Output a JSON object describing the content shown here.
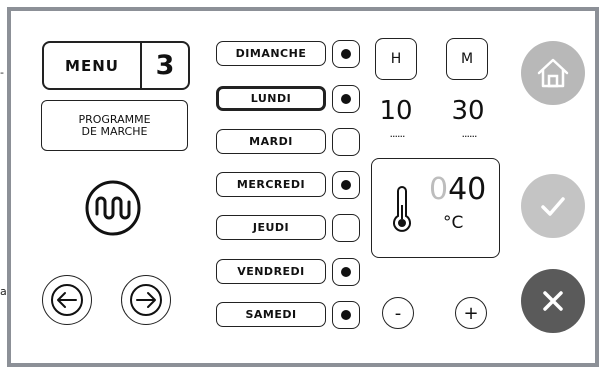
{
  "menu": {
    "label": "MENU",
    "number": "3"
  },
  "program_button": {
    "line1": "PROGRAMME",
    "line2": "DE MARCHE"
  },
  "days": [
    {
      "label": "DIMANCHE",
      "checked": true,
      "selected": false
    },
    {
      "label": "LUNDI",
      "checked": true,
      "selected": true
    },
    {
      "label": "MARDI",
      "checked": false,
      "selected": false
    },
    {
      "label": "MERCREDI",
      "checked": true,
      "selected": false
    },
    {
      "label": "JEUDI",
      "checked": false,
      "selected": false
    },
    {
      "label": "VENDREDI",
      "checked": true,
      "selected": false
    },
    {
      "label": "SAMEDI",
      "checked": true,
      "selected": false
    }
  ],
  "time": {
    "hour_label": "H",
    "minute_label": "M",
    "hour_value": "10",
    "minute_value": "30",
    "underline": "......"
  },
  "temperature": {
    "leading": "0",
    "value": "40",
    "unit": "°C"
  },
  "controls": {
    "minus": "-",
    "plus": "+"
  },
  "edge_glyphs": {
    "left_top": "-",
    "left_bottom": "a"
  },
  "icons": {
    "home": "home-icon",
    "confirm": "check-icon",
    "cancel": "close-icon",
    "heater": "heater-icon",
    "thermometer": "thermometer-icon",
    "prev": "arrow-left-icon",
    "next": "arrow-right-icon"
  },
  "colors": {
    "frame": "#8c9097",
    "home_button": "#b8b8b8",
    "confirm_button": "#c4c4c4",
    "cancel_button": "#5a5a5a",
    "dim_digit": "#bdbdbd"
  }
}
